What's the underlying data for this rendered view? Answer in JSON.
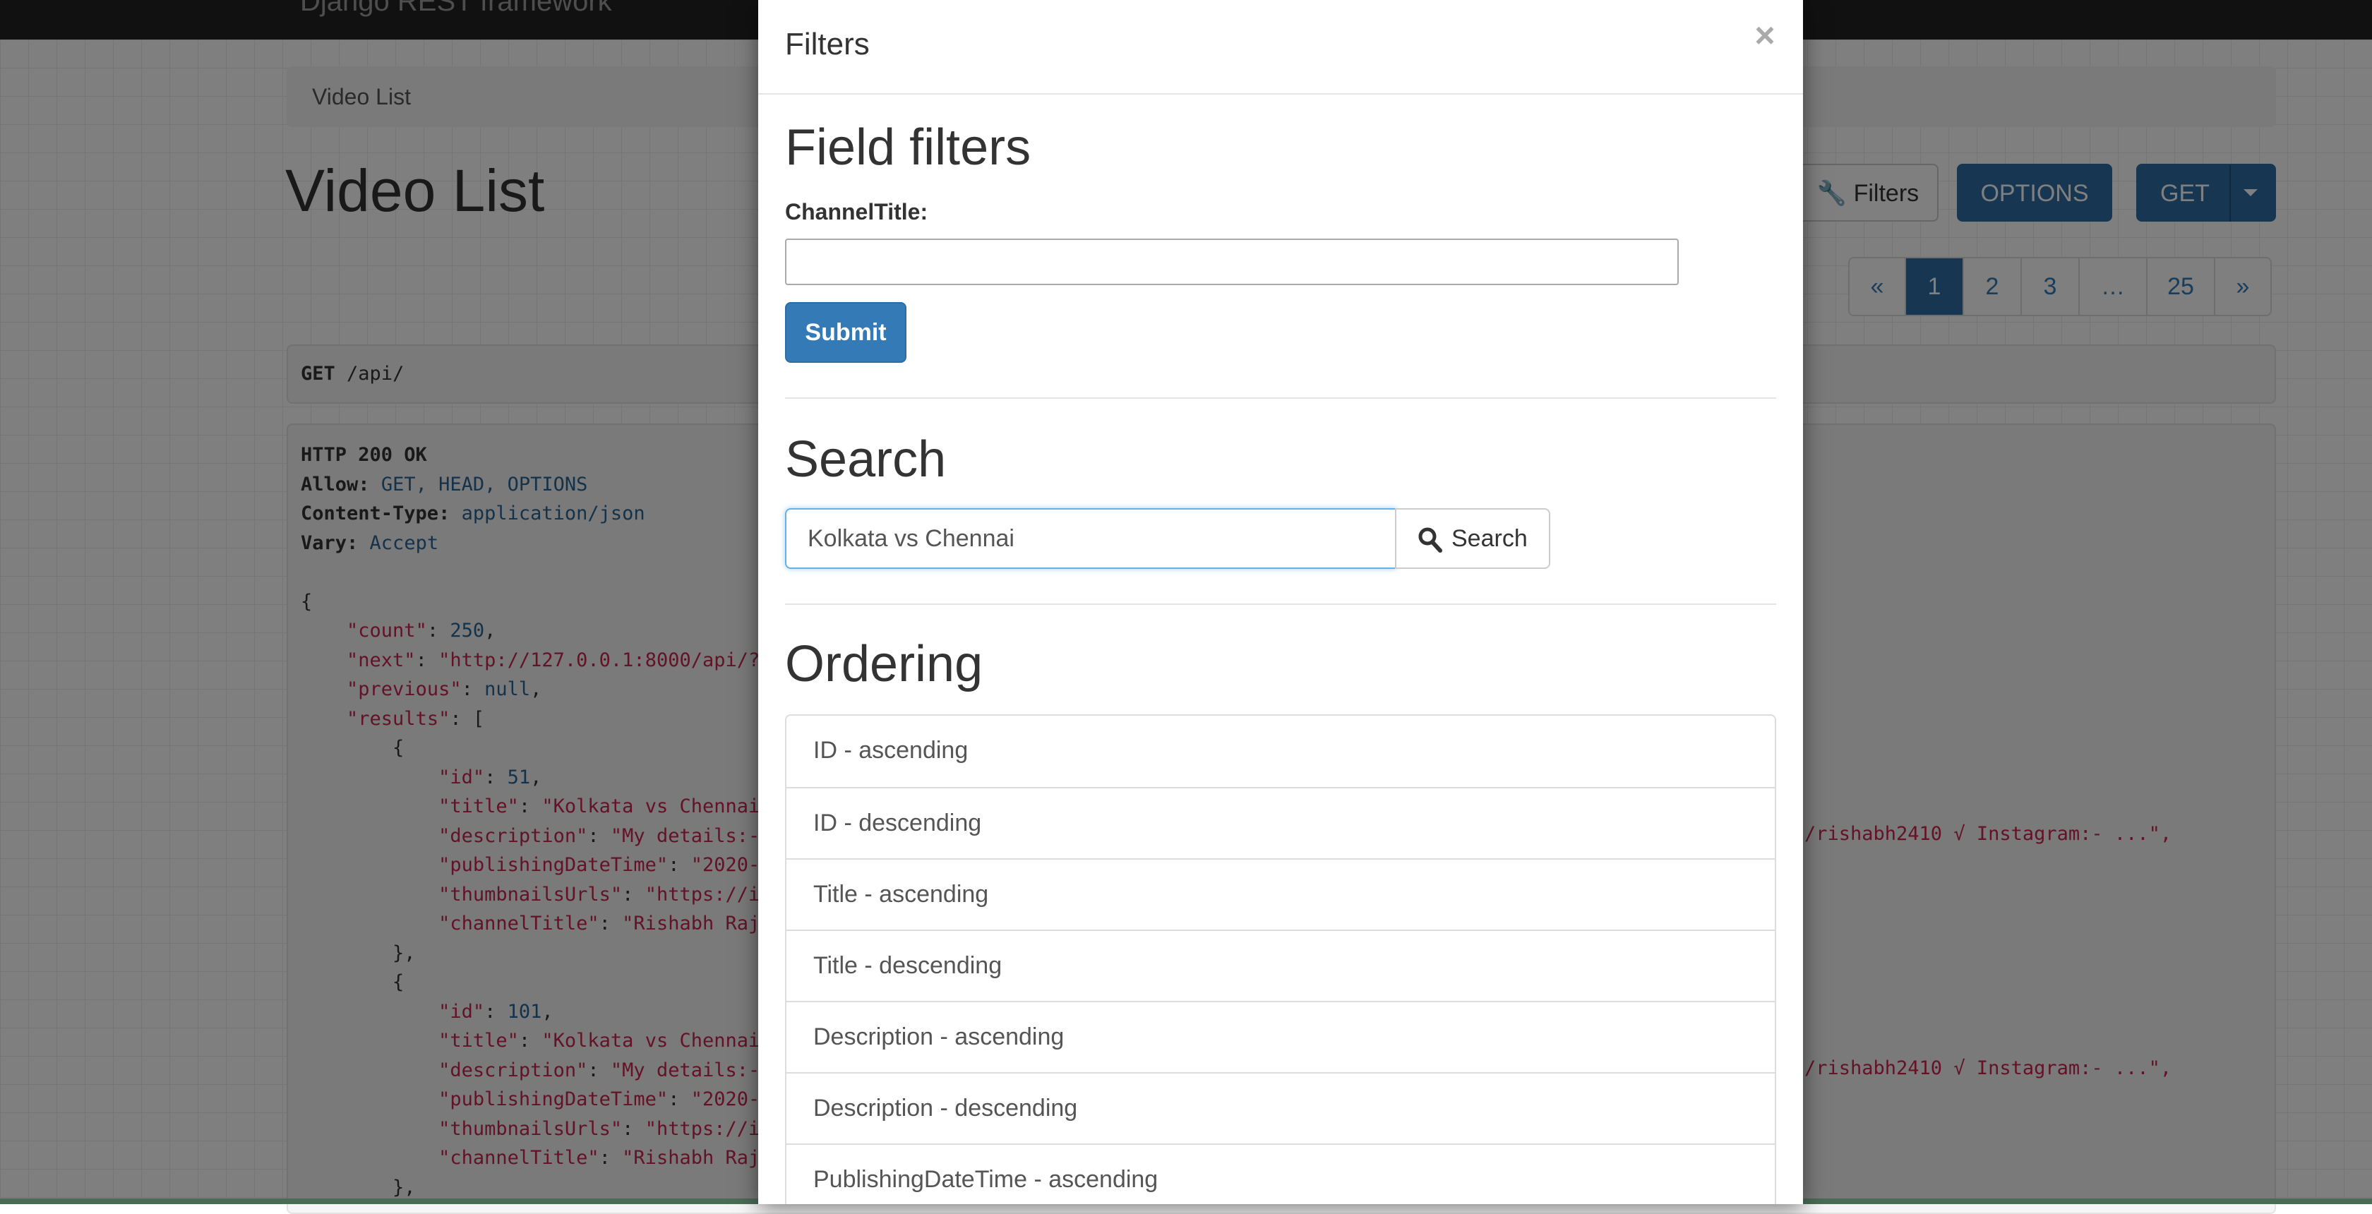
{
  "navbar": {
    "brand": "Django REST framework"
  },
  "breadcrumb": {
    "item": "Video List"
  },
  "page": {
    "title": "Video List"
  },
  "toolbar": {
    "filters_label": "Filters",
    "options_label": "OPTIONS",
    "get_label": "GET"
  },
  "pagination": {
    "prev": "«",
    "pages": [
      "1",
      "2",
      "3",
      "…",
      "25"
    ],
    "next": "»",
    "active": "1"
  },
  "request": {
    "method": "GET",
    "path": "/api/"
  },
  "response": {
    "status": "HTTP 200 OK",
    "allow_key": "Allow:",
    "allow_val": "GET, HEAD, OPTIONS",
    "ctype_key": "Content-Type:",
    "ctype_val": "application/json",
    "vary_key": "Vary:",
    "vary_val": "Accept",
    "lines": [
      "{",
      "    \"count\": 250,",
      "    \"next\": \"http://127.0.0.1:8000/api/?",
      "    \"previous\": null,",
      "    \"results\": [",
      "        {",
      "            \"id\": 51,",
      "            \"title\": \"Kolkata vs Chennai",
      "            \"description\": \"My details:-",
      "            \"publishingDateTime\": \"2020-",
      "            \"thumbnailsUrls\": \"https://i",
      "            \"channelTitle\": \"Rishabh Raj",
      "        },",
      "        {",
      "            \"id\": 101,",
      "            \"title\": \"Kolkata vs Chennai",
      "            \"description\": \"My details:-",
      "            \"publishingDateTime\": \"2020-",
      "            \"thumbnailsUrls\": \"https://i",
      "            \"channelTitle\": \"Rishabh Raj",
      "        },"
    ],
    "desc_tail": "/rishabh2410 √ Instagram:- ...\","
  },
  "modal": {
    "title": "Filters",
    "close": "×",
    "field_filters": {
      "heading": "Field filters",
      "label": "ChannelTitle:",
      "value": "",
      "submit": "Submit"
    },
    "search": {
      "heading": "Search",
      "value": "Kolkata vs Chennai",
      "button": "Search"
    },
    "ordering": {
      "heading": "Ordering",
      "items": [
        "ID - ascending",
        "ID - descending",
        "Title - ascending",
        "Title - descending",
        "Description - ascending",
        "Description - descending",
        "PublishingDateTime - ascending"
      ]
    }
  },
  "colors": {
    "primary": "#337ab7",
    "navbar": "#222222",
    "string": "#c7254e",
    "focus": "#66afe9"
  }
}
